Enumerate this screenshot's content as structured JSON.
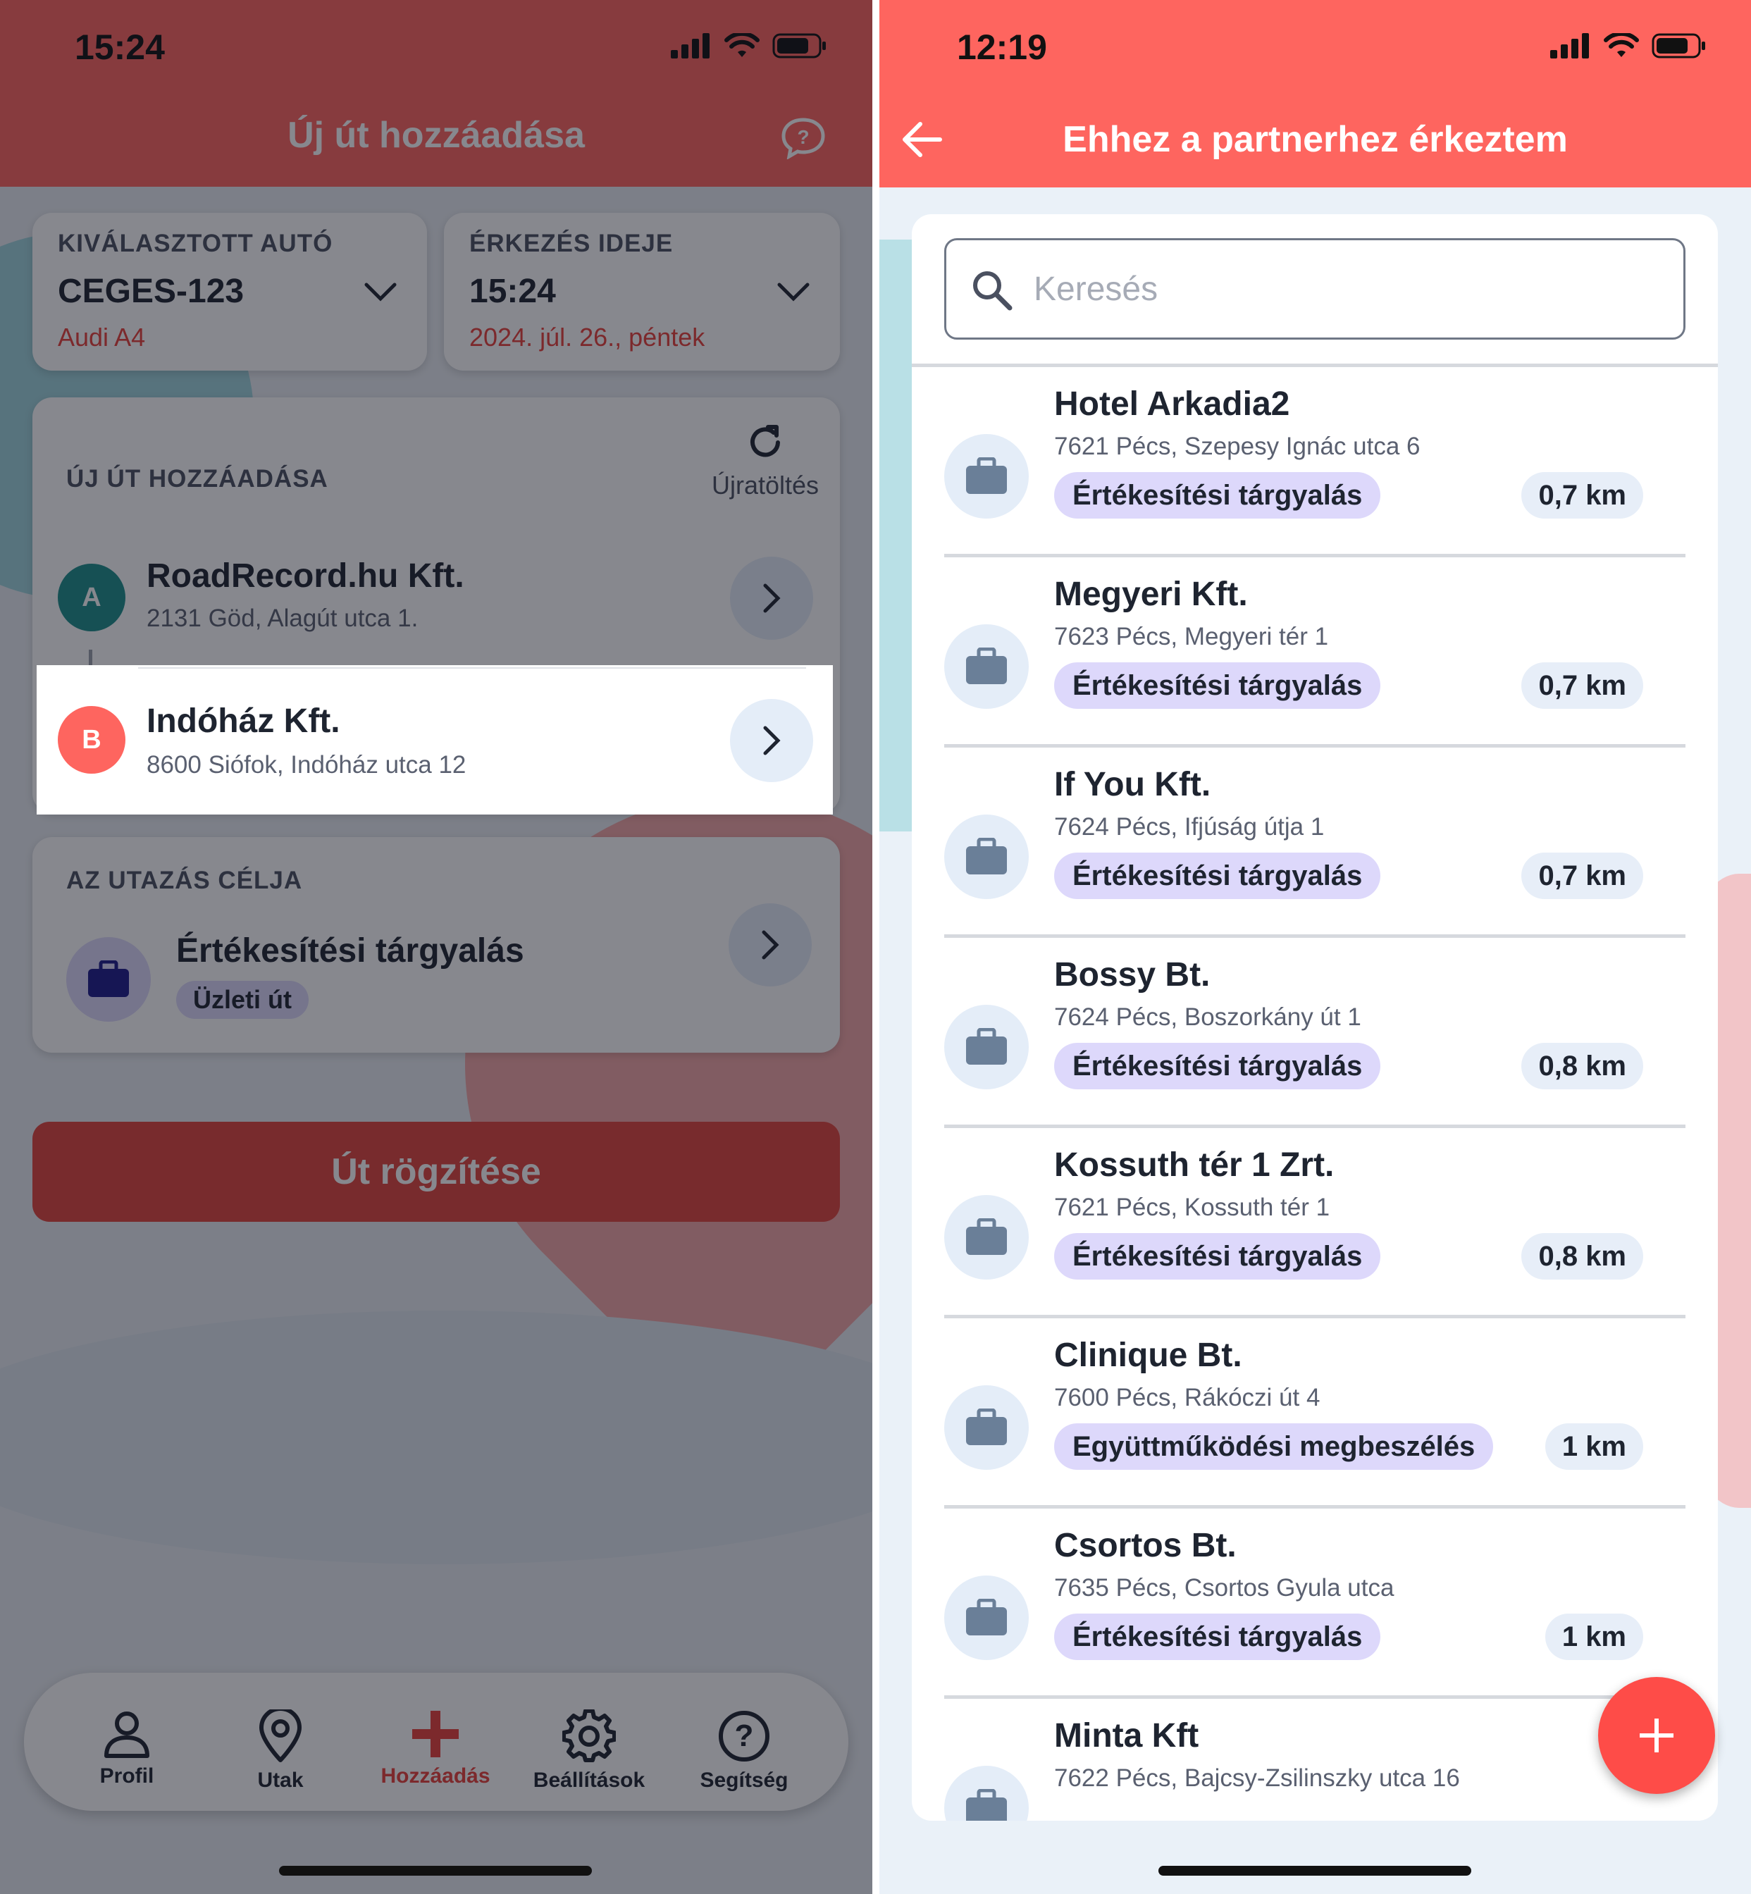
{
  "left": {
    "status_time": "15:24",
    "title": "Új út hozzáadása",
    "car": {
      "label": "KIVÁLASZTOTT AUTÓ",
      "plate": "CEGES-123",
      "model": "Audi A4"
    },
    "arrival": {
      "label": "ÉRKEZÉS IDEJE",
      "time": "15:24",
      "date": "2024. júl. 26., péntek"
    },
    "route": {
      "label": "ÚJ ÚT HOZZÁADÁSA",
      "reload_label": "Újratöltés",
      "stops": [
        {
          "badge": "A",
          "name": "RoadRecord.hu Kft.",
          "address": "2131 Göd, Alagút utca 1."
        },
        {
          "badge": "B",
          "name": "Indóház Kft.",
          "address": "8600 Siófok, Indóház utca 12"
        }
      ]
    },
    "purpose": {
      "label": "AZ UTAZÁS CÉLJA",
      "name": "Értékesítési tárgyalás",
      "tag": "Üzleti út"
    },
    "submit_label": "Út rögzítése",
    "tabs": [
      "Profil",
      "Utak",
      "Hozzáadás",
      "Beállítások",
      "Segítség"
    ],
    "colors": {
      "header": "#fe655f",
      "accent": "#e0443d",
      "stop_a": "#1c8e8a",
      "stop_b": "#fe655f"
    }
  },
  "right": {
    "status_time": "12:19",
    "title": "Ehhez a partnerhez érkeztem",
    "search_placeholder": "Keresés",
    "partners": [
      {
        "name": "Hotel Arkadia2",
        "address": "7621 Pécs, Szepesy Ignác utca 6",
        "tag": "Értékesítési tárgyalás",
        "distance": "0,7 km"
      },
      {
        "name": "Megyeri Kft.",
        "address": "7623 Pécs, Megyeri tér 1",
        "tag": "Értékesítési tárgyalás",
        "distance": "0,7 km"
      },
      {
        "name": "If You Kft.",
        "address": "7624 Pécs, Ifjúság útja 1",
        "tag": "Értékesítési tárgyalás",
        "distance": "0,7 km"
      },
      {
        "name": "Bossy Bt.",
        "address": "7624 Pécs, Boszorkány út 1",
        "tag": "Értékesítési tárgyalás",
        "distance": "0,8 km"
      },
      {
        "name": "Kossuth tér 1 Zrt.",
        "address": "7621 Pécs, Kossuth tér 1",
        "tag": "Értékesítési tárgyalás",
        "distance": "0,8 km"
      },
      {
        "name": "Clinique Bt.",
        "address": "7600 Pécs, Rákóczi út 4",
        "tag": "Együttműködési megbeszélés",
        "distance": "1 km"
      },
      {
        "name": "Csortos Bt.",
        "address": "7635 Pécs, Csortos Gyula utca",
        "tag": "Értékesítési tárgyalás",
        "distance": "1 km"
      },
      {
        "name": "Minta Kft",
        "address": "7622 Pécs, Bajcsy-Zsilinszky utca 16",
        "tag": "",
        "distance": ""
      }
    ],
    "colors": {
      "header": "#fe655f",
      "tag_bg": "#ddd8fb",
      "fab": "#fe4c48"
    }
  }
}
